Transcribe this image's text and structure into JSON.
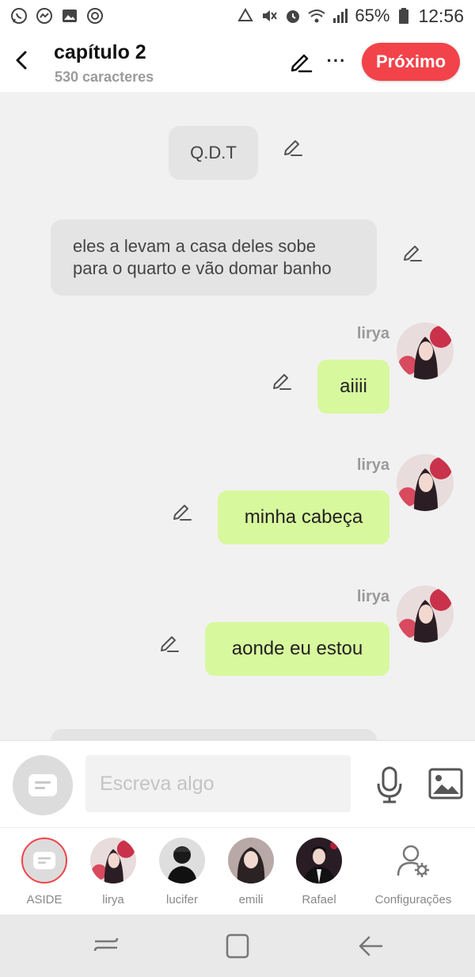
{
  "status_bar": {
    "battery": "65%",
    "time": "12:56",
    "icons": [
      "whatsapp-icon",
      "messenger-icon",
      "gallery-icon",
      "chrome-icon",
      "recycle-icon",
      "mute-icon",
      "alarm-icon",
      "wifi-icon",
      "signal-icon",
      "battery-icon"
    ]
  },
  "header": {
    "title": "capítulo 2",
    "subtitle": "530 caracteres",
    "next_label": "Próximo",
    "more_label": "···"
  },
  "messages": [
    {
      "type": "narration",
      "text": "Q.D.T"
    },
    {
      "type": "narration",
      "text": "eles a levam a casa deles sobe para o quarto e vão domar banho"
    },
    {
      "type": "character",
      "sender": "lirya",
      "text": "aiiii"
    },
    {
      "type": "character",
      "sender": "lirya",
      "text": "minha cabeça"
    },
    {
      "type": "character",
      "sender": "lirya",
      "text": "aonde eu estou"
    }
  ],
  "composer": {
    "placeholder": "Escreva algo"
  },
  "characters": [
    {
      "name": "ASIDE",
      "selected": true
    },
    {
      "name": "lirya"
    },
    {
      "name": "lucifer"
    },
    {
      "name": "emili"
    },
    {
      "name": "Rafael"
    },
    {
      "name": "Configurações"
    }
  ],
  "colors": {
    "accent": "#f2434a",
    "bubble_green": "#d8f89e",
    "bubble_gray": "#e4e4e4",
    "background": "#f1f1f1"
  }
}
